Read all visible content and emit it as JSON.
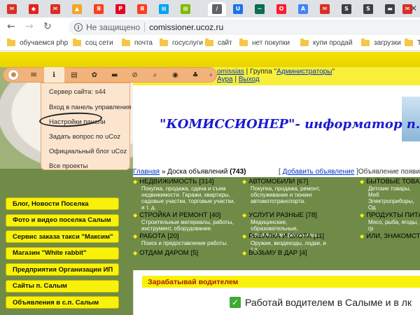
{
  "browser": {
    "tabs": [
      {
        "icon": "envelope-icon",
        "glyph": "✉",
        "color": "#d93025"
      },
      {
        "icon": "cube-icon",
        "glyph": "◆",
        "color": "#e2231a"
      },
      {
        "icon": "mail-ru-icon",
        "glyph": "✉",
        "color": "#d93025"
      },
      {
        "icon": "gold-icon",
        "glyph": "▲",
        "color": "#f5a623"
      },
      {
        "icon": "yandex-icon",
        "glyph": "Я",
        "color": "#fc3f1d"
      },
      {
        "icon": "pinterest-icon",
        "glyph": "P",
        "color": "#e60023"
      },
      {
        "icon": "yandex-icon",
        "glyph": "Я",
        "color": "#fc3f1d"
      },
      {
        "icon": "windows-icon",
        "glyph": "⊞",
        "color": "#00a4ef"
      },
      {
        "icon": "windows-icon",
        "glyph": "⊞",
        "color": "#7fba00"
      },
      {
        "icon": "active-page-icon",
        "glyph": "/",
        "color": "#5f6368"
      },
      {
        "icon": "odnoklassniki-icon",
        "glyph": "U",
        "color": "#1a73e8"
      },
      {
        "icon": "chart-icon",
        "glyph": "~",
        "color": "#0b6e4f"
      },
      {
        "icon": "opera-icon",
        "glyph": "O",
        "color": "#ff1b2d"
      },
      {
        "icon": "ads-icon",
        "glyph": "A",
        "color": "#4285f4"
      },
      {
        "icon": "mail-icon",
        "glyph": "✉",
        "color": "#d93025"
      },
      {
        "icon": "site-icon",
        "glyph": "S",
        "color": "#3c4043"
      },
      {
        "icon": "site-icon",
        "glyph": "S",
        "color": "#3c4043"
      },
      {
        "icon": "bar-icon",
        "glyph": "▬",
        "color": "#3c4043"
      },
      {
        "icon": "mail-icon",
        "glyph": "✉",
        "color": "#d93025"
      }
    ],
    "address": {
      "security_label": "Не защищено",
      "url": "comissioner.ucoz.ru"
    },
    "bookmarks": [
      "обучаемся php",
      "соц сети",
      "почта",
      "госуслуги",
      "сайт",
      "нет покупки",
      "купи продай",
      "загрузки",
      "Та"
    ]
  },
  "ucoz_panel": {
    "icons": [
      "person-icon",
      "envelope-icon",
      "info-icon",
      "book-icon",
      "palette-icon",
      "folder-icon",
      "ban-icon",
      "search-icon",
      "eye-icon",
      "plugin-icon",
      "collapse-icon"
    ],
    "menu": [
      "Сервер сайта: s44",
      "Вход в панель управления",
      "Настройки панели",
      "Задать вопрос по uCoz",
      "Официальный блог uCoz",
      "Все проекты"
    ]
  },
  "header": {
    "user_prefix": "",
    "user_name": "omissias",
    "group_sep": " | Группа \"",
    "group_name": "Администраторы",
    "group_end": "\"",
    "line2_link": "Аура",
    "line2_sep": " | ",
    "logout": "Выход",
    "site_title": "\"КОМИССИОНЕР\"- информатор п."
  },
  "breadcrumb": {
    "home": "Главная",
    "sep": " » Доска объявлений ",
    "count": "(743)",
    "add_open": "[ ",
    "add_link": "Добавить объявление",
    "add_close": " ]",
    "notice": "Объявление появится в"
  },
  "left_nav": [
    "Блог, Новости Поселка",
    "Фото и видео поселка Салым",
    "Сервис заказа такси \"Максим\"",
    "Магазин \"White rabbit\"",
    "Предприятия Организации ИП",
    "Сайты п. Салым",
    "Объявления в с.п. Салым"
  ],
  "categories": [
    {
      "title": "НЕДВИЖИМОСТЬ",
      "count": "[314]",
      "desc": "Покупка, продажа, сдача и съем недвижимости. Гаражи, квартиры, садовые участки, торговые участки, и т. д."
    },
    {
      "title": "АВТОМОБИЛИ",
      "count": "[67]",
      "desc": "Покупка, продажа, ремонт, обслуживание и тюнинг автомототранспорта."
    },
    {
      "title": "БЫТОВЫЕ ТОВАРЫ",
      "count": "",
      "desc": "Детские товары, Меб Электроприборы, Од"
    },
    {
      "title": "СТРОЙКА И РЕМОНТ",
      "count": "[40]",
      "desc": "Строительные материалы, работы, инструмент, оборудование."
    },
    {
      "title": "УСЛУГИ РАЗНЫЕ",
      "count": "[78]",
      "desc": "Медицинские, образовательные, юридические, ремонтные."
    },
    {
      "title": "ПРОДУКТЫ ПИТАНИ",
      "count": "",
      "desc": "Мясо, рыба, ягоды, гр"
    },
    {
      "title": "РАБОТА",
      "count": "[20]",
      "desc": "Поиск и предоставление работы."
    },
    {
      "title": "РЫБАЛКА И ОХОТА",
      "count": "[11]",
      "desc": "Оружие, вездеходы, лодки, и т.д."
    },
    {
      "title": "ИЛИ, ЗНАКОМСТВ",
      "count": "",
      "desc": ""
    },
    {
      "title": "ОТДАМ ДАРОМ",
      "count": "[5]",
      "desc": ""
    },
    {
      "title": "ВОЗЬМУ В ДАР",
      "count": "[4]",
      "desc": ""
    }
  ],
  "content": {
    "heading": "Зарабатывай водителем",
    "line": "Работай водителем в Салыме и в лк"
  }
}
